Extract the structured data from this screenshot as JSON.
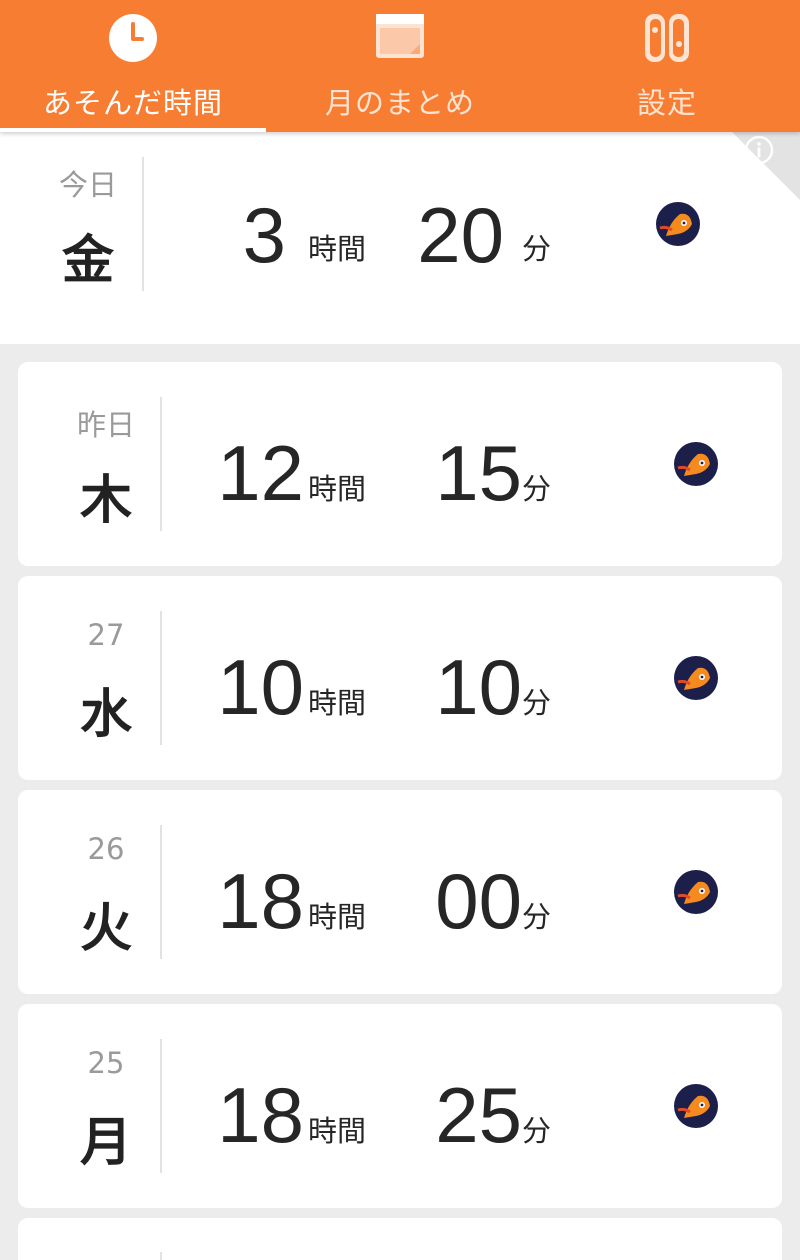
{
  "colors": {
    "accent": "#f77d33",
    "tab_inactive_label": "#fde3d2",
    "background": "#ececec",
    "card": "#ffffff"
  },
  "tabs": [
    {
      "label": "あそんだ時間",
      "icon": "clock-icon",
      "active": true
    },
    {
      "label": "月のまとめ",
      "icon": "calendar-icon",
      "active": false
    },
    {
      "label": "設定",
      "icon": "switch-console-icon",
      "active": false
    }
  ],
  "units": {
    "hours": "時間",
    "minutes": "分"
  },
  "days": [
    {
      "sub": "今日",
      "main": "金",
      "hours": "3",
      "minutes": "20",
      "game_icon": "splatoon-squid-icon"
    },
    {
      "sub": "昨日",
      "main": "木",
      "hours": "12",
      "minutes": "15",
      "game_icon": "splatoon-squid-icon"
    },
    {
      "sub": "27",
      "main": "水",
      "hours": "10",
      "minutes": "10",
      "game_icon": "splatoon-squid-icon"
    },
    {
      "sub": "26",
      "main": "火",
      "hours": "18",
      "minutes": "00",
      "game_icon": "splatoon-squid-icon"
    },
    {
      "sub": "25",
      "main": "月",
      "hours": "18",
      "minutes": "25",
      "game_icon": "splatoon-squid-icon"
    }
  ]
}
